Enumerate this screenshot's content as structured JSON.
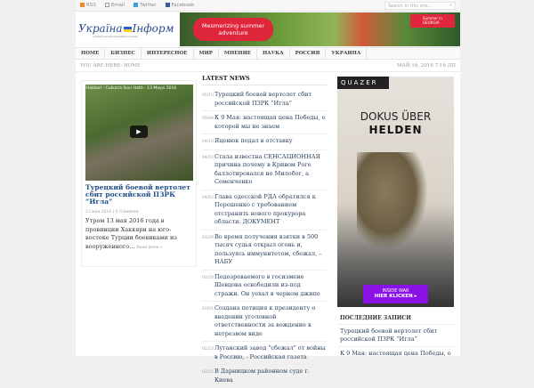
{
  "topbar": {
    "links": [
      "RSS",
      "Email",
      "Twitter",
      "Facebook"
    ],
    "search_placeholder": "Search in this site..."
  },
  "logo": {
    "text_left": "Україна",
    "text_right": "Інформ",
    "tagline": "українські інформаційні новини"
  },
  "banner": {
    "text": "Mesmerizing summer adventure",
    "badge": "Summer in GEORGIA"
  },
  "nav": [
    "HOME",
    "БИЗНЕС",
    "ИНТЕРЕСНОЕ",
    "МИР",
    "МНЕНИЕ",
    "НАУКА",
    "РОССИЯ",
    "УКРАИНА"
  ],
  "breadcrumb": {
    "label": "YOU ARE HERE:",
    "current": "HOME",
    "date": "МАЙ 16, 2016 7:16 ДП"
  },
  "featured": {
    "video_title": "Hakkari - Cukurca Sınır Hattı - 13 Mayıs 2016",
    "title": "Турецкий боевой вертолет сбит российской ПЗРК “Игла”",
    "date": "13 мая 2016",
    "comments": "0 Comment",
    "excerpt": "Утром 13 мая 2016 года в провинции Хаккяри на юго-востоке Турции боевиками из вооруженного...",
    "more": "Read more »"
  },
  "latest": {
    "title": "LATEST NEWS",
    "items": [
      {
        "date": "05/15",
        "text": "Турецкий боевой вертолет сбит российской ПЗРК “Игла”"
      },
      {
        "date": "05/04",
        "text": "К 9 Мая: настоящая цена Победы, о которой мы не знаем"
      },
      {
        "date": "04/10",
        "text": "Яценюк подал в отставку"
      },
      {
        "date": "04/03",
        "text": "Стала известна СЕНСАЦИОННАЯ причина почему в Кривом Роге баллотировался не Милобог, а Семенченко"
      },
      {
        "date": "04/02",
        "text": "Глава одесской РДА обратился к Порошенко с требованием отстранить нового прокурора области. ДОКУМЕНТ"
      },
      {
        "date": "03/29",
        "text": "Во время получения взятки в 500 тысяч судья открыл огонь и, пользуясь иммунитетом, сбежал, – НАБУ"
      },
      {
        "date": "03/20",
        "text": "Подозреваемого в госизмене Шевцова освободили из-под стражи. Он уехал в черном джипе"
      },
      {
        "date": "03/01",
        "text": "Создана петиция к президенту о введении уголовной ответственности за вождение в нетрезвом виде"
      },
      {
        "date": "02/23",
        "text": "Луганский завод \"сбежал\" от войны в Россию, - Российская газета"
      },
      {
        "date": "02/23",
        "text": "В Дарницком районном суде г. Киева"
      }
    ]
  },
  "ad": {
    "brand": "QUAZER",
    "line1": "DOKUS ÜBER",
    "line2": "HELDEN",
    "cta1": "INSIDE WAR",
    "cta2": "HIER KLICKEN ▸"
  },
  "sidebar": {
    "title": "ПОСЛЕДНИЕ ЗАПИСИ",
    "items": [
      "Турецкий боевой вертолет сбит российской ПЗРК “Игла”",
      "К 9 Мая: настоящая цена Победы, о"
    ]
  }
}
